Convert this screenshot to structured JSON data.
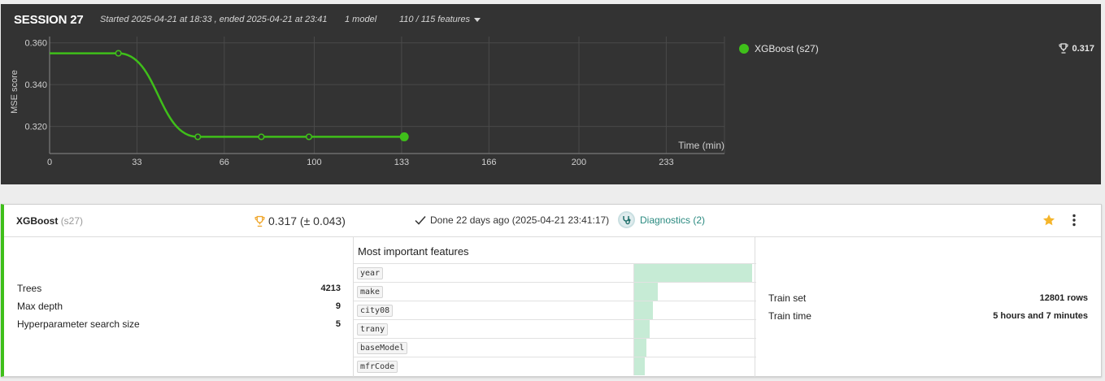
{
  "session": {
    "title": "SESSION 27",
    "started_text": "Started 2025-04-21 at 18:33 , ended 2025-04-21 at 23:41",
    "models_text": "1 model",
    "features_text": "110 / 115 features"
  },
  "legend": {
    "series_label": "XGBoost (s27)",
    "best_score": "0.317",
    "color": "#3fbf1a"
  },
  "chart_data": {
    "type": "line",
    "ylabel": "MSE score",
    "xlabel": "Time (min)",
    "x_ticks": [
      0,
      33,
      66,
      100,
      133,
      166,
      200,
      233
    ],
    "y_ticks": [
      0.32,
      0.34,
      0.36
    ],
    "y_tick_labels": [
      "0.320",
      "0.340",
      "0.360"
    ],
    "xlim": [
      0,
      255
    ],
    "ylim": [
      0.307,
      0.363
    ],
    "grid": true,
    "series": [
      {
        "name": "XGBoost (s27)",
        "color": "#3fbf1a",
        "x": [
          0,
          26,
          56,
          80,
          98,
          134
        ],
        "y": [
          0.355,
          0.355,
          0.315,
          0.315,
          0.315,
          0.315
        ],
        "markers": [
          26,
          56,
          80,
          98
        ],
        "end_marker": 134
      }
    ]
  },
  "card": {
    "model_name": "XGBoost",
    "model_session": "(s27)",
    "score": "0.317 (± 0.043)",
    "done_text": "Done 22 days ago (2025-04-21 23:41:17)",
    "diagnostics_label": "Diagnostics (2)",
    "star_color": "#f5b52b",
    "params": [
      {
        "label": "Trees",
        "value": "4213"
      },
      {
        "label": "Max depth",
        "value": "9"
      },
      {
        "label": "Hyperparameter search size",
        "value": "5"
      }
    ],
    "features_title": "Most important features",
    "features": [
      {
        "name": "year",
        "importance": 1.0
      },
      {
        "name": "make",
        "importance": 0.2
      },
      {
        "name": "city08",
        "importance": 0.16
      },
      {
        "name": "trany",
        "importance": 0.13
      },
      {
        "name": "baseModel",
        "importance": 0.1
      },
      {
        "name": "mfrCode",
        "importance": 0.09
      }
    ],
    "train": [
      {
        "label": "Train set",
        "value": "12801 rows"
      },
      {
        "label": "Train time",
        "value": "5 hours and 7 minutes"
      }
    ]
  }
}
